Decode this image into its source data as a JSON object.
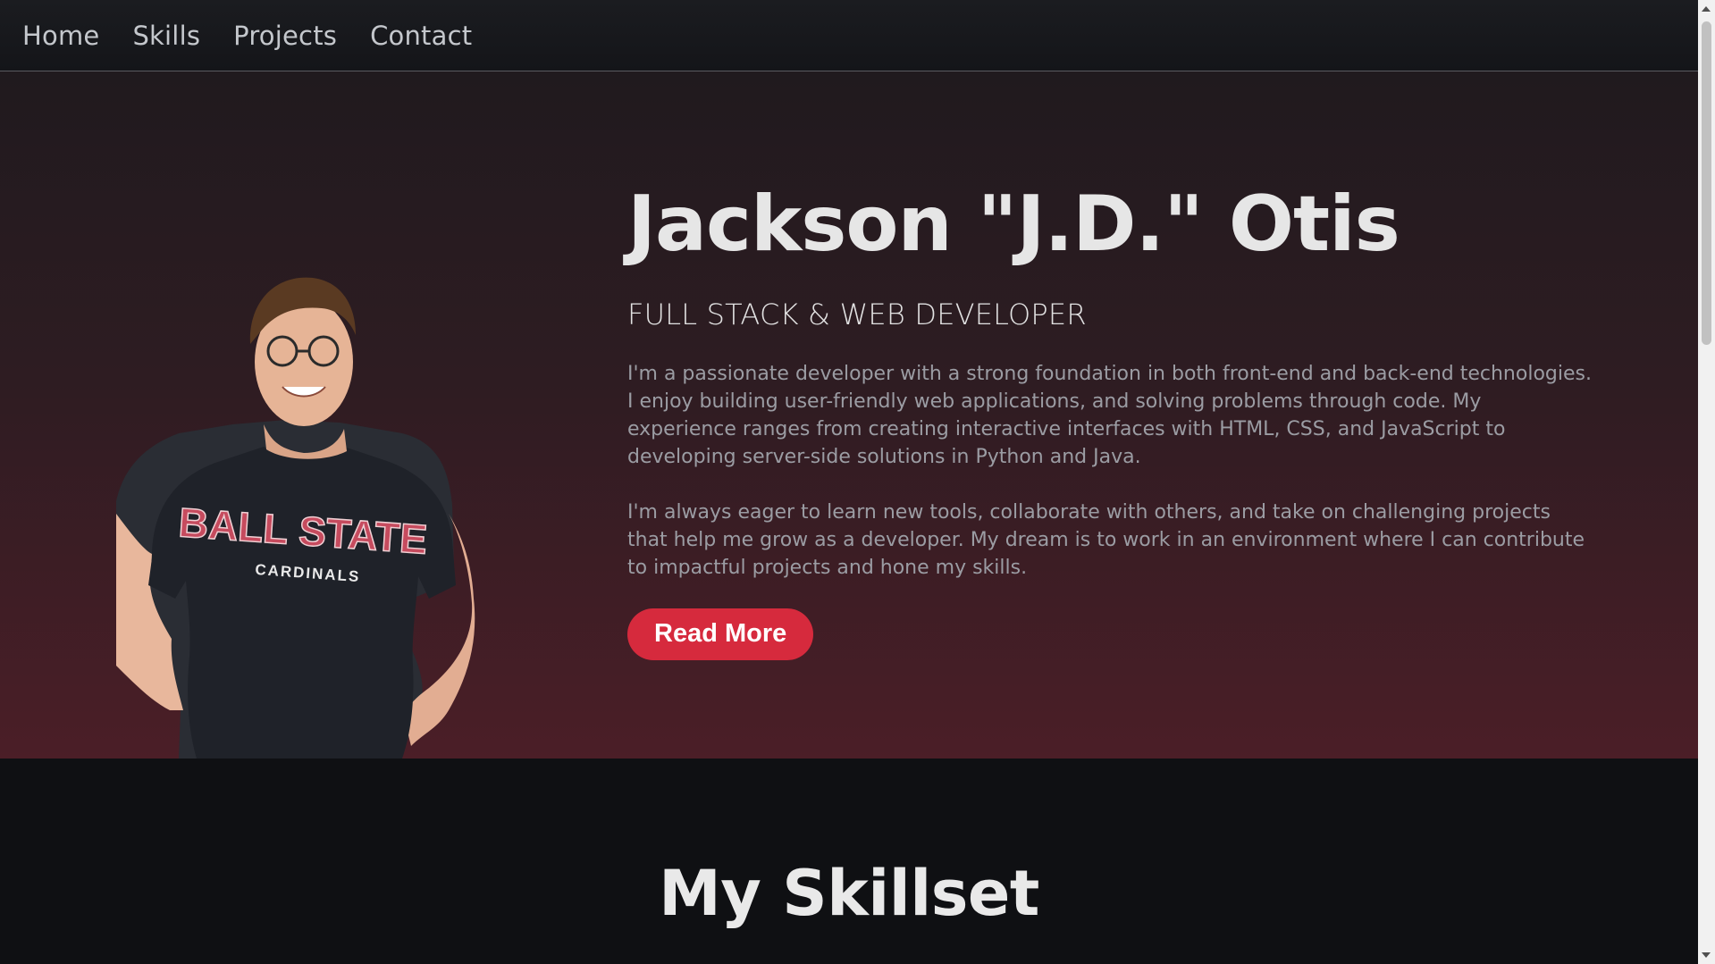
{
  "nav": {
    "items": [
      {
        "label": "Home"
      },
      {
        "label": "Skills"
      },
      {
        "label": "Projects"
      },
      {
        "label": "Contact"
      }
    ]
  },
  "hero": {
    "title": "Jackson \"J.D.\" Otis",
    "subtitle": "FULL STACK & WEB DEVELOPER",
    "paragraph1": "I'm a passionate developer with a strong foundation in both front-end and back-end technologies. I enjoy building user-friendly web applications, and solving problems through code. My experience ranges from creating interactive interfaces with HTML, CSS, and JavaScript to developing server-side solutions in Python and Java.",
    "paragraph2": "I'm always eager to learn new tools, collaborate with others, and take on challenging projects that help me grow as a developer. My dream is to work in an environment where I can contribute to impactful projects and hone my skills.",
    "button_label": "Read More",
    "shirt_text_top": "BALL STATE",
    "shirt_text_bottom": "CARDINALS"
  },
  "skills": {
    "heading": "My Skillset"
  },
  "colors": {
    "accent": "#d62a3d",
    "nav_bg": "#17181c",
    "hero_top": "#201a1e",
    "hero_bottom": "#4b1e27",
    "section_bg": "#0f1013"
  },
  "icons": {
    "scroll_up": "scroll-up-arrow-icon",
    "scroll_down": "scroll-down-arrow-icon"
  }
}
